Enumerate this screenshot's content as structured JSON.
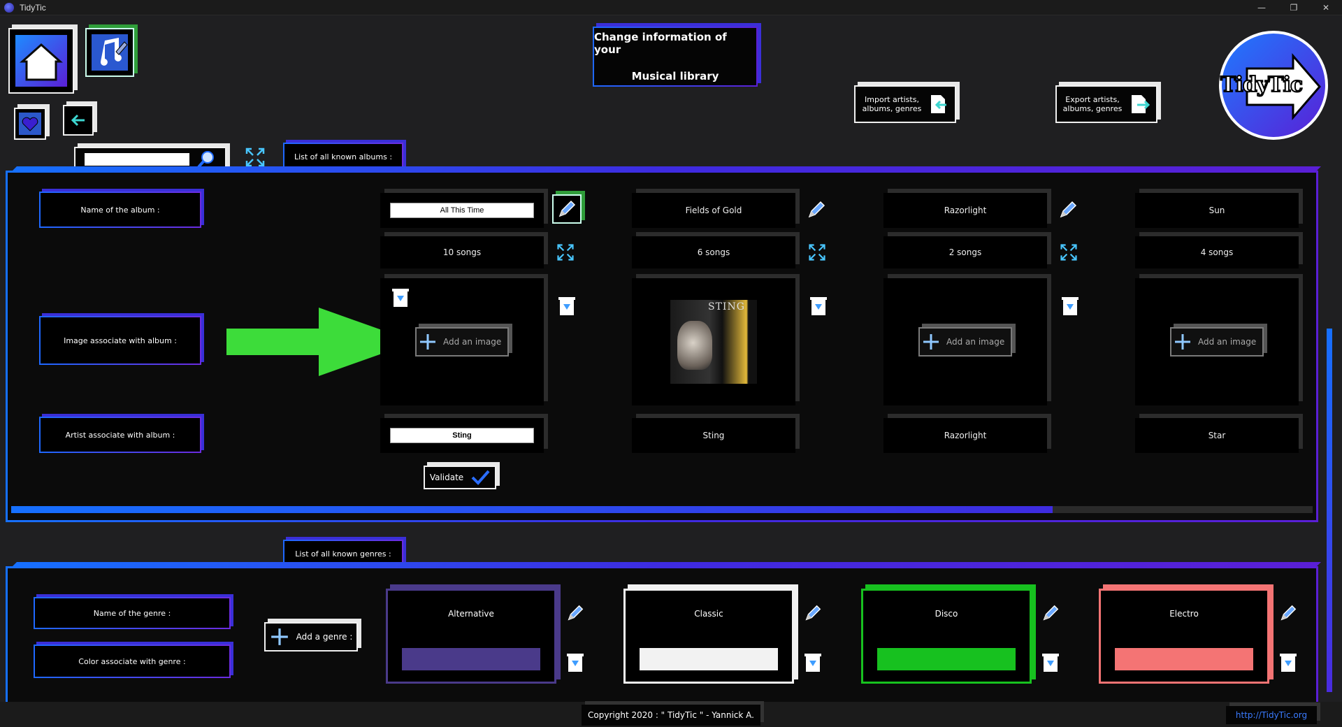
{
  "window": {
    "title": "TidyTic",
    "controls": [
      "—",
      "❐",
      "✕"
    ]
  },
  "header": {
    "title_line1": "Change information of your",
    "title_line2": "Musical library",
    "import_label_line1": "Import artists,",
    "import_label_line2": "albums, genres",
    "export_label_line1": "Export artists,",
    "export_label_line2": "albums, genres",
    "logo_text": "TidyTic"
  },
  "nav": {
    "icons": [
      "home-icon",
      "music-edit-icon",
      "heart-icon",
      "back-arrow-icon"
    ]
  },
  "search": {
    "value": "",
    "placeholder": ""
  },
  "albums_section": {
    "tab_label": "List of all known albums :",
    "row_labels": {
      "name": "Name of the album :",
      "image": "Image associate with album :",
      "artist": "Artist associate with album :"
    },
    "add_image_label": "Add an image",
    "validate_label": "Validate",
    "albums": [
      {
        "name": "All This Time",
        "songs": "10 songs",
        "artist": "Sting",
        "editing": true,
        "has_image": false
      },
      {
        "name": "Fields of Gold",
        "songs": "6 songs",
        "artist": "Sting",
        "editing": false,
        "has_image": true,
        "cover_text": "STING"
      },
      {
        "name": "Razorlight",
        "songs": "2 songs",
        "artist": "Razorlight",
        "editing": false,
        "has_image": false
      },
      {
        "name": "Sun",
        "songs": "4 songs",
        "artist": "Star",
        "editing": false,
        "has_image": false
      }
    ],
    "scroll_position": 0.8
  },
  "genres_section": {
    "tab_label": "List of all known genres :",
    "row_labels": {
      "name": "Name of the genre :",
      "color": "Color associate with genre :"
    },
    "add_genre_label": "Add a genre :",
    "genres": [
      {
        "name": "Alternative",
        "color": "#4a3a8a"
      },
      {
        "name": "Classic",
        "color": "#f2f2f2"
      },
      {
        "name": "Disco",
        "color": "#17c11f"
      },
      {
        "name": "Electro",
        "color": "#f47474"
      }
    ]
  },
  "footer": {
    "copyright": "Copyright 2020 : \" TidyTic \" - Yannick A.",
    "link": "http://TidyTic.org"
  },
  "colors": {
    "accent_blue": "#1670ff",
    "accent_purple": "#5a1fd6",
    "annotation_arrow": "#3ddc3a"
  }
}
